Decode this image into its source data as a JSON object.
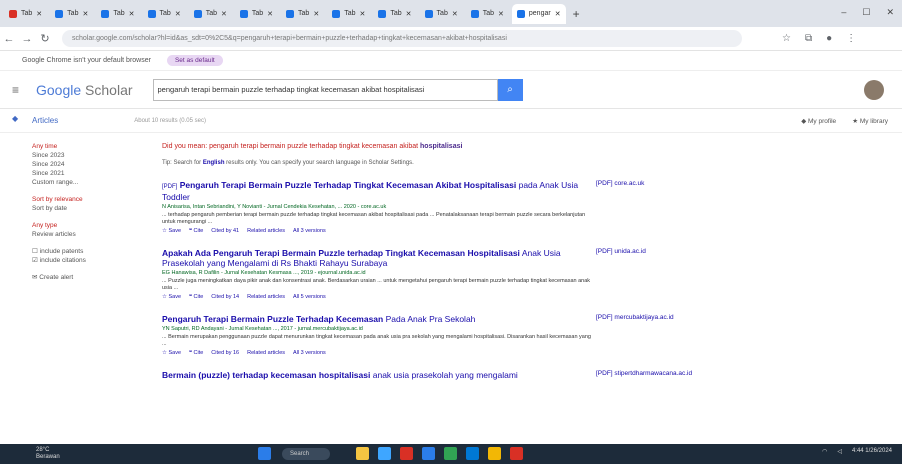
{
  "browser": {
    "tabs": [
      {
        "label": "Tab",
        "color": "#d93025"
      },
      {
        "label": "Tab",
        "color": "#1a73e8"
      },
      {
        "label": "Tab",
        "color": "#1a73e8"
      },
      {
        "label": "Tab",
        "color": "#1a73e8"
      },
      {
        "label": "Tab",
        "color": "#1a73e8"
      },
      {
        "label": "Tab",
        "color": "#1a73e8"
      },
      {
        "label": "Tab",
        "color": "#1a73e8"
      },
      {
        "label": "Tab",
        "color": "#1a73e8"
      },
      {
        "label": "Tab",
        "color": "#1a73e8"
      },
      {
        "label": "Tab",
        "color": "#1a73e8"
      },
      {
        "label": "Tab",
        "color": "#1a73e8"
      },
      {
        "label": "pengar",
        "color": "#1a73e8"
      }
    ],
    "new_tab": "+",
    "address": "scholar.google.com/scholar?hl=id&as_sdt=0%2C5&q=pengaruh+terapi+bermain+puzzle+terhadap+tingkat+kecemasan+akibat+hospitalisasi",
    "infobar_text": "Google Chrome isn't your default browser",
    "infobar_button": "Set as default"
  },
  "scholar": {
    "logo_google": "Google",
    "logo_scholar": "Scholar",
    "query": "pengaruh terapi bermain puzzle terhadap tingkat kecemasan akibat hospitalisasi",
    "articles_label": "Articles",
    "count_text": "About 10 results (0.05 sec)",
    "my_profile": "My profile",
    "my_library": "My library",
    "left": {
      "time": [
        "Any time",
        "Since 2023",
        "Since 2024",
        "Since 2021",
        "Custom range..."
      ],
      "sort": [
        "Sort by relevance",
        "Sort by date"
      ],
      "type": [
        "Any type",
        "Review articles"
      ],
      "checks": [
        "include patents",
        "include citations"
      ],
      "alert": "Create alert"
    },
    "did_you_mean_prefix": "Did you mean:",
    "did_you_mean_query": "pengaruh terapi bermain puzzle terhadap tingkat kecemasan akibat",
    "did_you_mean_bold": "hospitalisasi",
    "tip_prefix": "Tip: Search for",
    "tip_link": "English",
    "tip_suffix": "results only. You can specify your search language in Scholar Settings.",
    "results": [
      {
        "prefix": "[PDF]",
        "title_a": "Pengaruh Terapi Bermain Puzzle Terhadap Tingkat Kecemasan Akibat",
        "title_b": "Hospitalisasi",
        "title_c": "pada Anak Usia Toddler",
        "authors": "N Anisarisa, Intan Sebriandini, Y Novianti - Jurnal Cendekia Kesehatan, ... 2020 - core.ac.uk",
        "snippet": "... terhadap pengaruh pemberian terapi bermain puzzle terhadap tingkat kecemasan akibat hospitalisasi pada ... Penatalaksanaan terapi bermain puzzle secara berkelanjutan untuk mengurangi ...",
        "actions": [
          "Save",
          "Cite",
          "Cited by 41",
          "Related articles",
          "All 3 versions"
        ],
        "side": "[PDF] core.ac.uk"
      },
      {
        "prefix": "",
        "title_a": "Apakah Ada Pengaruh Terapi Bermain Puzzle terhadap Tingkat Kecemasan",
        "title_b": "Hospitalisasi",
        "title_c": "Anak Usia Prasekolah yang Mengalami di Rs Bhakti Rahayu Surabaya",
        "authors": "EG Hanawisa, R Dafilin - Jurnal Kesehatan Kesmasa ..., 2019 - ejournal.unida.ac.id",
        "snippet": "... Puzzle juga meningkatkan daya pikir anak dan konsentrasi anak. Berdasarkan uraian ... untuk mengetahui pengaruh terapi bermain puzzle terhadap tingkat kecemasan anak usia ...",
        "actions": [
          "Save",
          "Cite",
          "Cited by 14",
          "Related articles",
          "All 5 versions"
        ],
        "side": "[PDF] unida.ac.id"
      },
      {
        "prefix": "",
        "title_a": "Pengaruh Terapi Bermain Puzzle Terhadap Kecemasan",
        "title_b": "",
        "title_c": "Pada Anak Pra Sekolah",
        "authors": "YN Saputri, RD Andayani - Jurnal Kesehatan ..., 2017 - jurnal.mercubaktijaya.ac.id",
        "snippet": "... Bermain merupakan penggunaan puzzle dapat menurunkan tingkat kecemasan pada anak usia pra sekolah yang mengalami hospitalisasi. Disarankan hasil kecemasan yang ...",
        "actions": [
          "Save",
          "Cite",
          "Cited by 16",
          "Related articles",
          "All 3 versions"
        ],
        "side": "[PDF] mercubaktijaya.ac.id"
      },
      {
        "prefix": "",
        "title_a": "Bermain (puzzle) terhadap kecemasan",
        "title_b": "hospitalisasi",
        "title_c": "anak usia prasekolah yang mengalami",
        "authors": "",
        "snippet": "",
        "actions": [],
        "side": "[PDF] stipertdharmawacana.ac.id"
      }
    ]
  },
  "taskbar": {
    "weather_temp": "28°C",
    "weather_desc": "Berawan",
    "search": "Search",
    "time": "4:44",
    "date": "1/26/2024",
    "colors": [
      "#2b7de9",
      "#f5c542",
      "#3ea6ff",
      "#d93025",
      "#2b7de9",
      "#31a354",
      "#0078d4",
      "#f2b705",
      "#d93025"
    ]
  }
}
